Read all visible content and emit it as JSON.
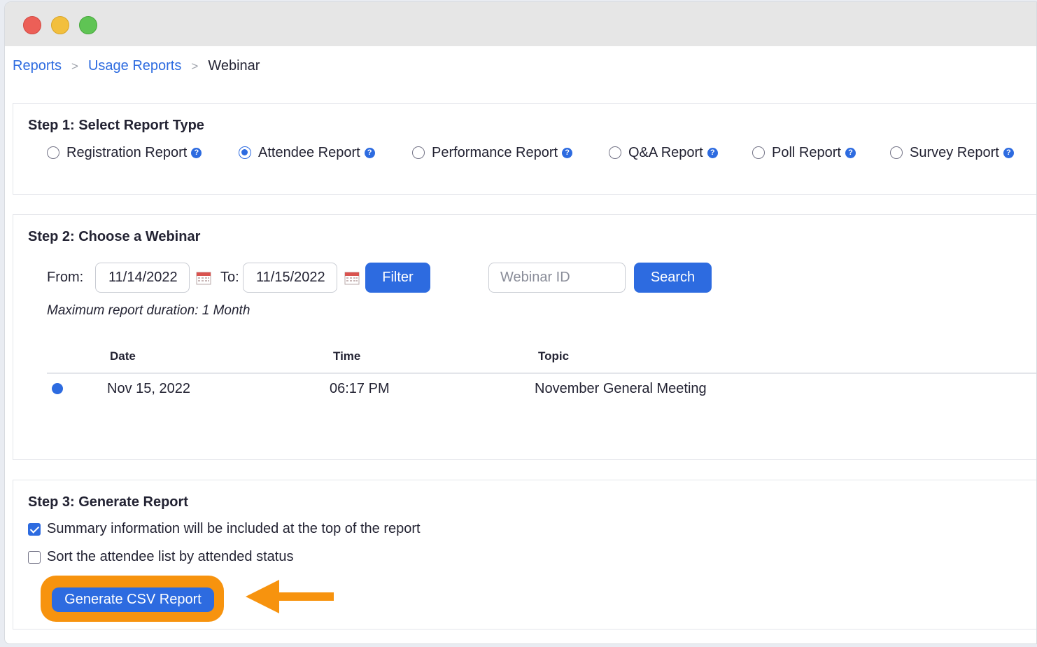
{
  "breadcrumb": {
    "items": [
      "Reports",
      "Usage Reports"
    ],
    "separator": ">",
    "current": "Webinar"
  },
  "step1": {
    "title": "Step 1: Select Report Type",
    "options": [
      {
        "label": "Registration Report",
        "checked": false
      },
      {
        "label": "Attendee Report",
        "checked": true
      },
      {
        "label": "Performance Report",
        "checked": false
      },
      {
        "label": "Q&A Report",
        "checked": false
      },
      {
        "label": "Poll Report",
        "checked": false
      },
      {
        "label": "Survey Report",
        "checked": false
      }
    ],
    "help_glyph": "?"
  },
  "step2": {
    "title": "Step 2: Choose a Webinar",
    "from_label": "From:",
    "from_value": "11/14/2022",
    "to_label": "To:",
    "to_value": "11/15/2022",
    "filter_label": "Filter",
    "webinar_id_placeholder": "Webinar ID",
    "search_label": "Search",
    "note": "Maximum report duration: 1 Month",
    "table": {
      "headers": [
        "Date",
        "Time",
        "Topic"
      ],
      "rows": [
        {
          "date": "Nov 15, 2022",
          "time": "06:17 PM",
          "topic": "November General Meeting",
          "selected": true
        }
      ]
    }
  },
  "step3": {
    "title": "Step 3: Generate Report",
    "options": [
      {
        "label": "Summary information will be included at the top of the report",
        "checked": true
      },
      {
        "label": "Sort the attendee list by attended status",
        "checked": false
      }
    ],
    "generate_label": "Generate CSV Report"
  },
  "colors": {
    "accent": "#2d6be0",
    "highlight": "#f7930e"
  }
}
